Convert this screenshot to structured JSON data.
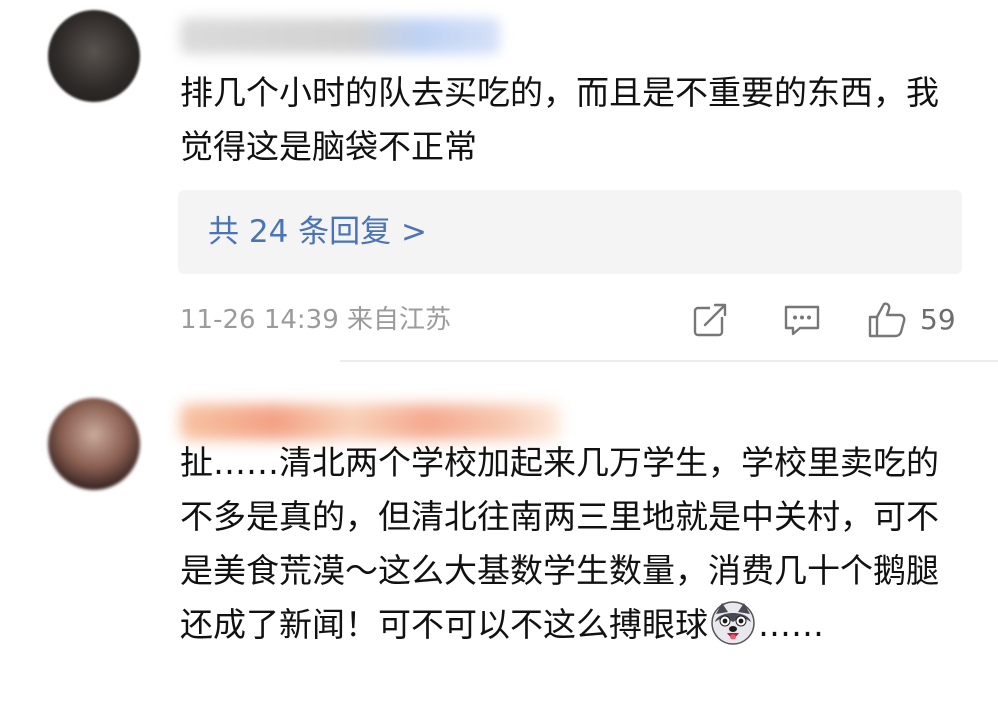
{
  "comments": [
    {
      "text": "排几个小时的队去买吃的，而且是不重要的东西，我觉得这是脑袋不正常",
      "reply_link": "共 24 条回复 >",
      "timestamp": "11-26 14:39 来自江苏",
      "likes": "59",
      "icons": [
        "share-icon",
        "comment-icon",
        "thumbs-up-icon"
      ]
    },
    {
      "text_before_emoji": "扯……清北两个学校加起来几万学生，学校里卖吃的不多是真的，但清北往南两三里地就是中关村，可不是美食荒漠～这么大基数学生数量，消费几十个鹅腿还成了新闻！可不可以不这么搏眼球",
      "emoji": "husky-emoji",
      "text_after_emoji": "……"
    }
  ],
  "colors": {
    "link": "#4a74b5",
    "meta": "#9b9b9b",
    "reply_bg": "#f4f4f4"
  }
}
